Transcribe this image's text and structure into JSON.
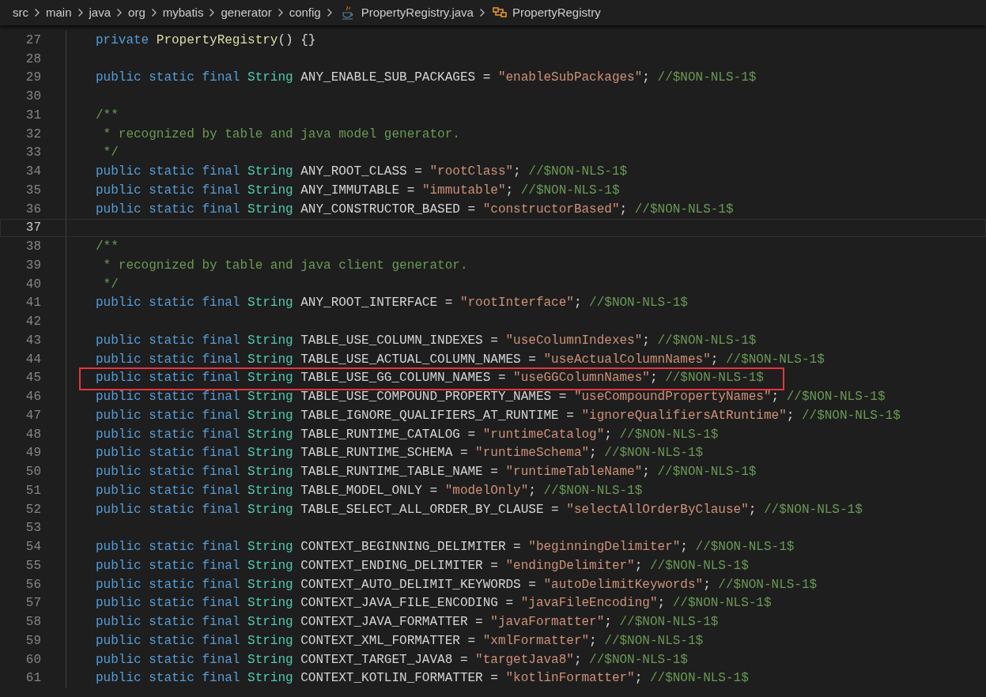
{
  "breadcrumb": [
    {
      "kind": "folder",
      "text": "src"
    },
    {
      "kind": "folder",
      "text": "main"
    },
    {
      "kind": "folder",
      "text": "java"
    },
    {
      "kind": "folder",
      "text": "org"
    },
    {
      "kind": "folder",
      "text": "mybatis"
    },
    {
      "kind": "folder",
      "text": "generator"
    },
    {
      "kind": "folder",
      "text": "config"
    },
    {
      "kind": "file",
      "text": "PropertyRegistry.java"
    },
    {
      "kind": "class",
      "text": "PropertyRegistry"
    }
  ],
  "lines": [
    {
      "number": "27",
      "current": false,
      "highlighted": false,
      "tokens": [
        {
          "kind": "kw",
          "text": "private "
        },
        {
          "kind": "fn",
          "text": "PropertyRegistry"
        },
        {
          "kind": "plain",
          "text": "() {}"
        }
      ]
    },
    {
      "number": "28",
      "current": false,
      "highlighted": false
    },
    {
      "number": "29",
      "current": false,
      "highlighted": false,
      "tokens": [
        {
          "kind": "kw",
          "text": "public static final "
        },
        {
          "kind": "type",
          "text": "String"
        },
        {
          "kind": "plain",
          "text": " ANY_ENABLE_SUB_PACKAGES = "
        },
        {
          "kind": "str",
          "text": "\"enableSubPackages\""
        },
        {
          "kind": "plain",
          "text": "; "
        },
        {
          "kind": "comment",
          "text": "//$NON-NLS-1$"
        }
      ]
    },
    {
      "number": "30",
      "current": false,
      "highlighted": false
    },
    {
      "number": "31",
      "current": false,
      "highlighted": false,
      "tokens": [
        {
          "kind": "comment",
          "text": "/**"
        }
      ]
    },
    {
      "number": "32",
      "current": false,
      "highlighted": false,
      "tokens": [
        {
          "kind": "comment",
          "text": " * recognized by table and java model generator."
        }
      ]
    },
    {
      "number": "33",
      "current": false,
      "highlighted": false,
      "tokens": [
        {
          "kind": "comment",
          "text": " */"
        }
      ]
    },
    {
      "number": "34",
      "current": false,
      "highlighted": false,
      "tokens": [
        {
          "kind": "kw",
          "text": "public static final "
        },
        {
          "kind": "type",
          "text": "String"
        },
        {
          "kind": "plain",
          "text": " ANY_ROOT_CLASS = "
        },
        {
          "kind": "str",
          "text": "\"rootClass\""
        },
        {
          "kind": "plain",
          "text": "; "
        },
        {
          "kind": "comment",
          "text": "//$NON-NLS-1$"
        }
      ]
    },
    {
      "number": "35",
      "current": false,
      "highlighted": false,
      "tokens": [
        {
          "kind": "kw",
          "text": "public static final "
        },
        {
          "kind": "type",
          "text": "String"
        },
        {
          "kind": "plain",
          "text": " ANY_IMMUTABLE = "
        },
        {
          "kind": "str",
          "text": "\"immutable\""
        },
        {
          "kind": "plain",
          "text": "; "
        },
        {
          "kind": "comment",
          "text": "//$NON-NLS-1$"
        }
      ]
    },
    {
      "number": "36",
      "current": false,
      "highlighted": false,
      "tokens": [
        {
          "kind": "kw",
          "text": "public static final "
        },
        {
          "kind": "type",
          "text": "String"
        },
        {
          "kind": "plain",
          "text": " ANY_CONSTRUCTOR_BASED = "
        },
        {
          "kind": "str",
          "text": "\"constructorBased\""
        },
        {
          "kind": "plain",
          "text": "; "
        },
        {
          "kind": "comment",
          "text": "//$NON-NLS-1$"
        }
      ]
    },
    {
      "number": "37",
      "current": true,
      "highlighted": false
    },
    {
      "number": "38",
      "current": false,
      "highlighted": false,
      "tokens": [
        {
          "kind": "comment",
          "text": "/**"
        }
      ]
    },
    {
      "number": "39",
      "current": false,
      "highlighted": false,
      "tokens": [
        {
          "kind": "comment",
          "text": " * recognized by table and java client generator."
        }
      ]
    },
    {
      "number": "40",
      "current": false,
      "highlighted": false,
      "tokens": [
        {
          "kind": "comment",
          "text": " */"
        }
      ]
    },
    {
      "number": "41",
      "current": false,
      "highlighted": false,
      "tokens": [
        {
          "kind": "kw",
          "text": "public static final "
        },
        {
          "kind": "type",
          "text": "String"
        },
        {
          "kind": "plain",
          "text": " ANY_ROOT_INTERFACE = "
        },
        {
          "kind": "str",
          "text": "\"rootInterface\""
        },
        {
          "kind": "plain",
          "text": "; "
        },
        {
          "kind": "comment",
          "text": "//$NON-NLS-1$"
        }
      ]
    },
    {
      "number": "42",
      "current": false,
      "highlighted": false
    },
    {
      "number": "43",
      "current": false,
      "highlighted": false,
      "tokens": [
        {
          "kind": "kw",
          "text": "public static final "
        },
        {
          "kind": "type",
          "text": "String"
        },
        {
          "kind": "plain",
          "text": " TABLE_USE_COLUMN_INDEXES = "
        },
        {
          "kind": "str",
          "text": "\"useColumnIndexes\""
        },
        {
          "kind": "plain",
          "text": "; "
        },
        {
          "kind": "comment",
          "text": "//$NON-NLS-1$"
        }
      ]
    },
    {
      "number": "44",
      "current": false,
      "highlighted": false,
      "tokens": [
        {
          "kind": "kw",
          "text": "public static final "
        },
        {
          "kind": "type",
          "text": "String"
        },
        {
          "kind": "plain",
          "text": " TABLE_USE_ACTUAL_COLUMN_NAMES = "
        },
        {
          "kind": "str",
          "text": "\"useActualColumnNames\""
        },
        {
          "kind": "plain",
          "text": "; "
        },
        {
          "kind": "comment",
          "text": "//$NON-NLS-1$"
        }
      ]
    },
    {
      "number": "45",
      "current": false,
      "highlighted": true,
      "tokens": [
        {
          "kind": "kw",
          "text": "public static final "
        },
        {
          "kind": "type",
          "text": "String"
        },
        {
          "kind": "plain",
          "text": " TABLE_USE_GG_COLUMN_NAMES = "
        },
        {
          "kind": "str",
          "text": "\"useGGColumnNames\""
        },
        {
          "kind": "plain",
          "text": "; "
        },
        {
          "kind": "comment",
          "text": "//$NON-NLS-1$"
        }
      ]
    },
    {
      "number": "46",
      "current": false,
      "highlighted": false,
      "tokens": [
        {
          "kind": "kw",
          "text": "public static final "
        },
        {
          "kind": "type",
          "text": "String"
        },
        {
          "kind": "plain",
          "text": " TABLE_USE_COMPOUND_PROPERTY_NAMES = "
        },
        {
          "kind": "str",
          "text": "\"useCompoundPropertyNames\""
        },
        {
          "kind": "plain",
          "text": "; "
        },
        {
          "kind": "comment",
          "text": "//$NON-NLS-1$"
        }
      ]
    },
    {
      "number": "47",
      "current": false,
      "highlighted": false,
      "tokens": [
        {
          "kind": "kw",
          "text": "public static final "
        },
        {
          "kind": "type",
          "text": "String"
        },
        {
          "kind": "plain",
          "text": " TABLE_IGNORE_QUALIFIERS_AT_RUNTIME = "
        },
        {
          "kind": "str",
          "text": "\"ignoreQualifiersAtRuntime\""
        },
        {
          "kind": "plain",
          "text": "; "
        },
        {
          "kind": "comment",
          "text": "//$NON-NLS-1$"
        }
      ]
    },
    {
      "number": "48",
      "current": false,
      "highlighted": false,
      "tokens": [
        {
          "kind": "kw",
          "text": "public static final "
        },
        {
          "kind": "type",
          "text": "String"
        },
        {
          "kind": "plain",
          "text": " TABLE_RUNTIME_CATALOG = "
        },
        {
          "kind": "str",
          "text": "\"runtimeCatalog\""
        },
        {
          "kind": "plain",
          "text": "; "
        },
        {
          "kind": "comment",
          "text": "//$NON-NLS-1$"
        }
      ]
    },
    {
      "number": "49",
      "current": false,
      "highlighted": false,
      "tokens": [
        {
          "kind": "kw",
          "text": "public static final "
        },
        {
          "kind": "type",
          "text": "String"
        },
        {
          "kind": "plain",
          "text": " TABLE_RUNTIME_SCHEMA = "
        },
        {
          "kind": "str",
          "text": "\"runtimeSchema\""
        },
        {
          "kind": "plain",
          "text": "; "
        },
        {
          "kind": "comment",
          "text": "//$NON-NLS-1$"
        }
      ]
    },
    {
      "number": "50",
      "current": false,
      "highlighted": false,
      "tokens": [
        {
          "kind": "kw",
          "text": "public static final "
        },
        {
          "kind": "type",
          "text": "String"
        },
        {
          "kind": "plain",
          "text": " TABLE_RUNTIME_TABLE_NAME = "
        },
        {
          "kind": "str",
          "text": "\"runtimeTableName\""
        },
        {
          "kind": "plain",
          "text": "; "
        },
        {
          "kind": "comment",
          "text": "//$NON-NLS-1$"
        }
      ]
    },
    {
      "number": "51",
      "current": false,
      "highlighted": false,
      "tokens": [
        {
          "kind": "kw",
          "text": "public static final "
        },
        {
          "kind": "type",
          "text": "String"
        },
        {
          "kind": "plain",
          "text": " TABLE_MODEL_ONLY = "
        },
        {
          "kind": "str",
          "text": "\"modelOnly\""
        },
        {
          "kind": "plain",
          "text": "; "
        },
        {
          "kind": "comment",
          "text": "//$NON-NLS-1$"
        }
      ]
    },
    {
      "number": "52",
      "current": false,
      "highlighted": false,
      "tokens": [
        {
          "kind": "kw",
          "text": "public static final "
        },
        {
          "kind": "type",
          "text": "String"
        },
        {
          "kind": "plain",
          "text": " TABLE_SELECT_ALL_ORDER_BY_CLAUSE = "
        },
        {
          "kind": "str",
          "text": "\"selectAllOrderByClause\""
        },
        {
          "kind": "plain",
          "text": "; "
        },
        {
          "kind": "comment",
          "text": "//$NON-NLS-1$"
        }
      ]
    },
    {
      "number": "53",
      "current": false,
      "highlighted": false
    },
    {
      "number": "54",
      "current": false,
      "highlighted": false,
      "tokens": [
        {
          "kind": "kw",
          "text": "public static final "
        },
        {
          "kind": "type",
          "text": "String"
        },
        {
          "kind": "plain",
          "text": " CONTEXT_BEGINNING_DELIMITER = "
        },
        {
          "kind": "str",
          "text": "\"beginningDelimiter\""
        },
        {
          "kind": "plain",
          "text": "; "
        },
        {
          "kind": "comment",
          "text": "//$NON-NLS-1$"
        }
      ]
    },
    {
      "number": "55",
      "current": false,
      "highlighted": false,
      "tokens": [
        {
          "kind": "kw",
          "text": "public static final "
        },
        {
          "kind": "type",
          "text": "String"
        },
        {
          "kind": "plain",
          "text": " CONTEXT_ENDING_DELIMITER = "
        },
        {
          "kind": "str",
          "text": "\"endingDelimiter\""
        },
        {
          "kind": "plain",
          "text": "; "
        },
        {
          "kind": "comment",
          "text": "//$NON-NLS-1$"
        }
      ]
    },
    {
      "number": "56",
      "current": false,
      "highlighted": false,
      "tokens": [
        {
          "kind": "kw",
          "text": "public static final "
        },
        {
          "kind": "type",
          "text": "String"
        },
        {
          "kind": "plain",
          "text": " CONTEXT_AUTO_DELIMIT_KEYWORDS = "
        },
        {
          "kind": "str",
          "text": "\"autoDelimitKeywords\""
        },
        {
          "kind": "plain",
          "text": "; "
        },
        {
          "kind": "comment",
          "text": "//$NON-NLS-1$"
        }
      ]
    },
    {
      "number": "57",
      "current": false,
      "highlighted": false,
      "tokens": [
        {
          "kind": "kw",
          "text": "public static final "
        },
        {
          "kind": "type",
          "text": "String"
        },
        {
          "kind": "plain",
          "text": " CONTEXT_JAVA_FILE_ENCODING = "
        },
        {
          "kind": "str",
          "text": "\"javaFileEncoding\""
        },
        {
          "kind": "plain",
          "text": "; "
        },
        {
          "kind": "comment",
          "text": "//$NON-NLS-1$"
        }
      ]
    },
    {
      "number": "58",
      "current": false,
      "highlighted": false,
      "tokens": [
        {
          "kind": "kw",
          "text": "public static final "
        },
        {
          "kind": "type",
          "text": "String"
        },
        {
          "kind": "plain",
          "text": " CONTEXT_JAVA_FORMATTER = "
        },
        {
          "kind": "str",
          "text": "\"javaFormatter\""
        },
        {
          "kind": "plain",
          "text": "; "
        },
        {
          "kind": "comment",
          "text": "//$NON-NLS-1$"
        }
      ]
    },
    {
      "number": "59",
      "current": false,
      "highlighted": false,
      "tokens": [
        {
          "kind": "kw",
          "text": "public static final "
        },
        {
          "kind": "type",
          "text": "String"
        },
        {
          "kind": "plain",
          "text": " CONTEXT_XML_FORMATTER = "
        },
        {
          "kind": "str",
          "text": "\"xmlFormatter\""
        },
        {
          "kind": "plain",
          "text": "; "
        },
        {
          "kind": "comment",
          "text": "//$NON-NLS-1$"
        }
      ]
    },
    {
      "number": "60",
      "current": false,
      "highlighted": false,
      "tokens": [
        {
          "kind": "kw",
          "text": "public static final "
        },
        {
          "kind": "type",
          "text": "String"
        },
        {
          "kind": "plain",
          "text": " CONTEXT_TARGET_JAVA8 = "
        },
        {
          "kind": "str",
          "text": "\"targetJava8\""
        },
        {
          "kind": "plain",
          "text": "; "
        },
        {
          "kind": "comment",
          "text": "//$NON-NLS-1$"
        }
      ]
    },
    {
      "number": "61",
      "current": false,
      "highlighted": false,
      "tokens": [
        {
          "kind": "kw",
          "text": "public static final "
        },
        {
          "kind": "type",
          "text": "String"
        },
        {
          "kind": "plain",
          "text": " CONTEXT_KOTLIN_FORMATTER = "
        },
        {
          "kind": "str",
          "text": "\"kotlinFormatter\""
        },
        {
          "kind": "plain",
          "text": "; "
        },
        {
          "kind": "comment",
          "text": "//$NON-NLS-1$"
        }
      ]
    }
  ]
}
